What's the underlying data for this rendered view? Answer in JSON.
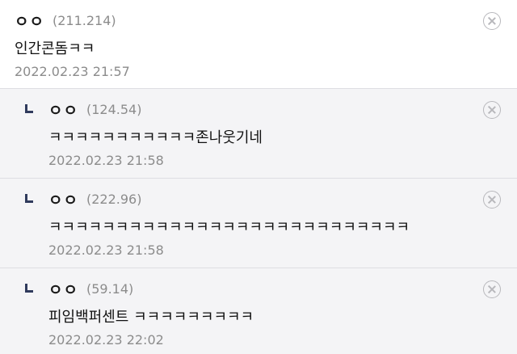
{
  "comments": [
    {
      "nick": "ㅇㅇ",
      "ip": "(211.214)",
      "text": "인간콘돔ㅋㅋ",
      "date": "2022.02.23 21:57"
    },
    {
      "nick": "ㅇㅇ",
      "ip": "(124.54)",
      "text": "ㅋㅋㅋㅋㅋㅋㅋㅋㅋㅋㅋ존나웃기네",
      "date": "2022.02.23 21:58"
    },
    {
      "nick": "ㅇㅇ",
      "ip": "(222.96)",
      "text": "ㅋㅋㅋㅋㅋㅋㅋㅋㅋㅋㅋㅋㅋㅋㅋㅋㅋㅋㅋㅋㅋㅋㅋㅋㅋㅋㅋ",
      "date": "2022.02.23 21:58"
    },
    {
      "nick": "ㅇㅇ",
      "ip": "(59.14)",
      "text": "피임백퍼센트 ㅋㅋㅋㅋㅋㅋㅋㅋㅋ",
      "date": "2022.02.23 22:02"
    }
  ],
  "icons": {
    "delete": "close-circle-icon",
    "reply": "reply-arrow-icon"
  },
  "colors": {
    "reply_background": "#f4f4f6",
    "reply_marker": "#2f3a5c",
    "meta_text": "#8c8c8c",
    "divider": "#dedee2"
  }
}
